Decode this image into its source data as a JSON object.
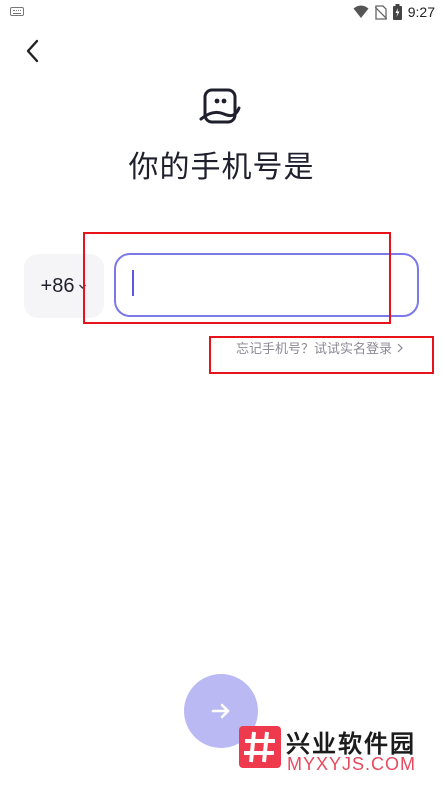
{
  "status_bar": {
    "time": "9:27",
    "icons": [
      "keyboard-icon",
      "wifi-icon",
      "no-sim-icon",
      "battery-charging-icon"
    ]
  },
  "header": {
    "back_icon": "chevron-left-icon",
    "logo_icon": "app-logo-icon"
  },
  "main": {
    "title": "你的手机号是",
    "country_code": "+86",
    "phone_input": {
      "value": "",
      "placeholder": ""
    },
    "forgot_link": "忘记手机号？试试实名登录"
  },
  "footer": {
    "next_icon": "arrow-right-icon"
  },
  "watermark": {
    "title": "兴业软件园",
    "subtitle": "MYXYJS.COM"
  },
  "colors": {
    "accent": "#7b78e8",
    "next_button": "#bab9f3",
    "highlight": "#e8121b",
    "watermark": "#ef3a4e"
  }
}
